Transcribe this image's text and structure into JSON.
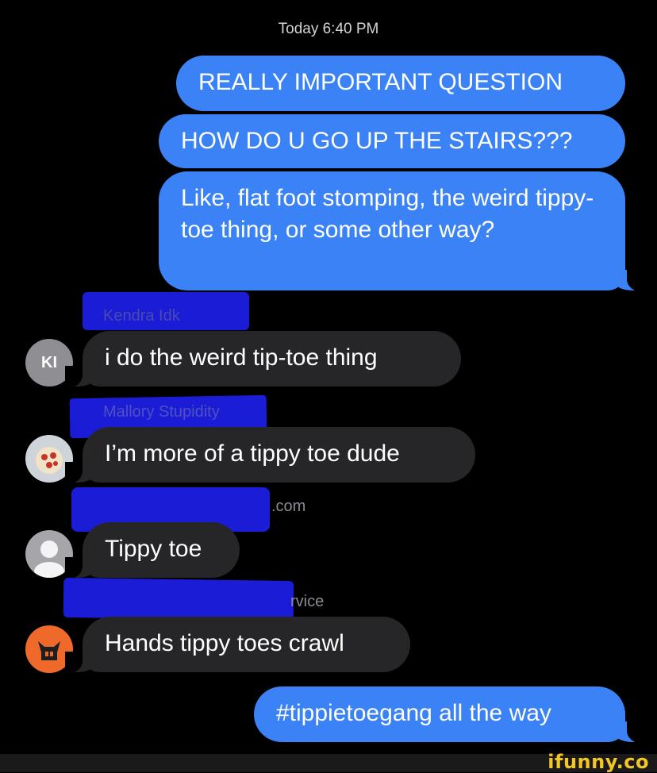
{
  "timestamp": "Today 6:40 PM",
  "outgoing": [
    {
      "text": "REALLY IMPORTANT QUESTION"
    },
    {
      "text": "HOW DO U GO UP THE STAIRS???"
    },
    {
      "text": "Like, flat foot stomping, the weird tippy-toe thing, or some other way?"
    },
    {
      "text": "#tippietoegang all the way"
    }
  ],
  "incoming": [
    {
      "sender": "Kendra Idk",
      "avatar": "KI",
      "text": "i do the weird tip-toe thing"
    },
    {
      "sender": "Mallory Stupidity",
      "avatar": "pizza-avatar",
      "text": "I’m more of a tippy toe dude"
    },
    {
      "sender": ".com",
      "avatar": "generic-person-avatar",
      "text": "Tippy toe"
    },
    {
      "sender": "rvice",
      "avatar": "cat-mask-avatar",
      "text": "Hands tippy toes crawl"
    }
  ],
  "watermark": "ifunny.co",
  "colors": {
    "background": "#000000",
    "outgoing_bubble": "#3a82f6",
    "incoming_bubble": "#262629",
    "redaction_scribble": "#1c1ee8",
    "watermark": "#f3c623"
  }
}
